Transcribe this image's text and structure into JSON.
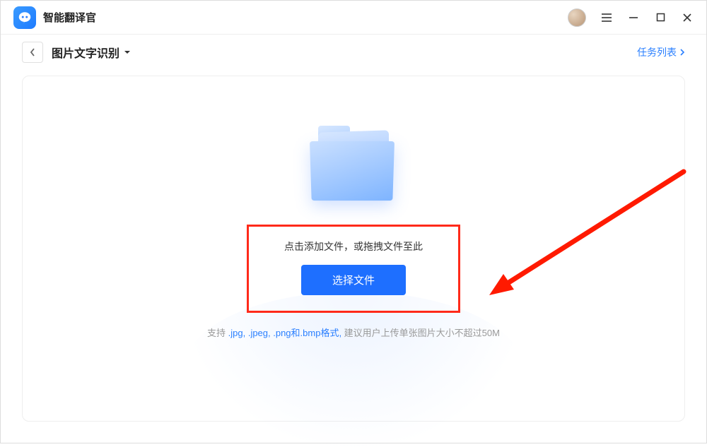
{
  "app": {
    "title": "智能翻译官"
  },
  "toolbar": {
    "page_title": "图片文字识别",
    "task_list": "任务列表"
  },
  "drop": {
    "hint": "点击添加文件，或拖拽文件至此",
    "button": "选择文件"
  },
  "support": {
    "prefix": "支持",
    "formats": " .jpg, .jpeg, .png和.bmp格式,",
    "suffix": " 建议用户上传单张图片大小不超过50M"
  }
}
